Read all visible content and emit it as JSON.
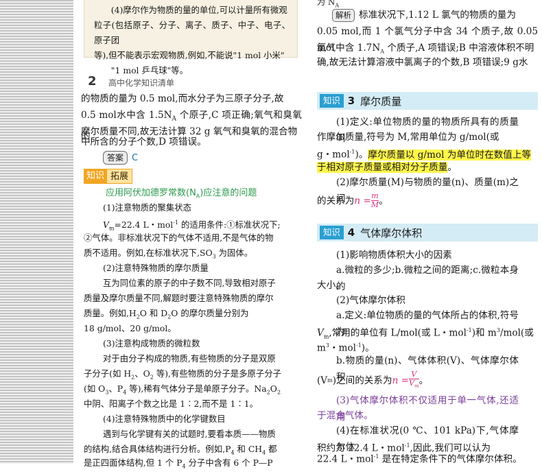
{
  "left": {
    "note": [
      "(4)摩尔作为物质的量的单位,可以计量所有微观",
      "粒子(包括原子、分子、离子、质子、中子、电子、原子团",
      "等),但不能表示宏观物质,例如,不能说\"1 mol 小米\"",
      "\"1 mol 乒乓球\"等。"
    ],
    "page_number": "2",
    "page_title": "高中化学知识清单",
    "para": [
      "的物质的量为 0.5 mol,而水分子为三原子分子,故",
      "0.5 mol水中含 1.5N",
      "A",
      " 个原子,C 项正确;氧气和臭氧的",
      "摩尔质量不同,故无法计算 32 g 氧气和臭氧的混合物",
      "中所含的分子个数,D 项错误。"
    ],
    "answer_label": "答案",
    "answer_value": "C",
    "ext_tag_a": "知识",
    "ext_tag_b": "拓展",
    "ext_title": "应用阿伏加德罗常数(N",
    "ext_title_sub": "A",
    "ext_title_end": ")应注意的问题",
    "ext_lines": [
      "(1)注意物质的聚集状态",
      "V",
      "m",
      "=22.4 L・mol",
      "-1",
      " 的适用条件:①标准状况下;",
      "②气体。非标准状况下的气体不适用,不是气体的物",
      "质不适用。例如,在标准状况下,SO",
      "3",
      " 为固体。",
      "(2)注意特殊物质的摩尔质量",
      "互为同位素的原子的中子数不同,导致相对原子",
      "质量及摩尔质量不同,解题时要注意特殊物质的摩尔",
      "质量。例如,H",
      "2",
      "O 和 D",
      "2",
      "O 的摩尔质量分别为",
      "18 g/mol、20 g/mol。",
      "(3)注意构成物质的微粒数",
      "对于由分子构成的物质,有些物质的分子是双原",
      "子分子(如 H",
      "2",
      "、O",
      "2",
      " 等),有些物质的分子是多原子分子",
      "(如 O",
      "3",
      "、P",
      "4",
      " 等),稀有气体分子是单原子分子。Na",
      "2",
      "O",
      "2",
      "中阴、阳离子个数之比是 1∶2,而不是 1∶1。",
      "(4)注意特殊物质中的化学键数目",
      "遇到与化学键有关的试题时,要看本质——物质",
      "的结构,结合具体结构进行分析。例如,P",
      "4",
      " 和 CH",
      "4",
      " 都",
      "是正四面体结构,但 1 个 P",
      "4",
      " 分子中含有 6 个 P—P"
    ]
  },
  "right": {
    "top_na": "为 N",
    "top_na_sub": "A",
    "analysis_label": "解析",
    "analysis": [
      "标准状况下,1.12 L 氯气的物质的量为",
      "0.05 mol,而 1 个氯气分子中含 34 个质子,故 0.05 mol",
      "氯气中含 1.7N",
      "A",
      " 个质子,A 项错误;B 中溶液体积不明",
      "确,故无法计算溶液中氯离子的个数,B 项错误;9 g水"
    ],
    "sec3_tag": "知识",
    "sec3_num": "3",
    "sec3_title": "摩尔质量",
    "sec3": [
      "(1)定义:单位物质的量的物质所具有的质量叫",
      "作摩尔质量,符号为 M,常用单位为 g/mol(或",
      "g・mol",
      "-1",
      ")。",
      "摩尔质量以 g/mol 为单位时在数值上等",
      "于相对原子质量或相对分子质量",
      "。",
      "(2)摩尔质量(M)与物质的量(n)、质量(m)之间",
      "的关系为",
      "n = ",
      "m",
      "M",
      "。"
    ],
    "sec4_tag": "知识",
    "sec4_num": "4",
    "sec4_title": "气体摩尔体积",
    "sec4": [
      "(1)影响物质体积大小的因素",
      "a.微粒的多少;b.微粒之间的距离;c.微粒本身的",
      "大小。",
      "(2)气体摩尔体积",
      "a.定义:单位物质的量的气体所占的体积,符号为",
      "V",
      "m",
      ",常用的单位有 L/mol(或 L・mol",
      "-1",
      ")和 m",
      "3",
      "/mol(或",
      "m",
      "3",
      "・mol",
      "-1",
      ")。",
      "b.物质的量(n)、气体体积(V)、气体摩尔体积",
      "(V",
      "m",
      ")之间的关系为",
      "n = ",
      "V",
      "V",
      "m",
      "。",
      "(3)气体摩尔体积不仅适用于单一气体,还适用",
      "于混合气体。",
      "(4)在标准状况(0 ℃、101 kPa)下,气体摩尔体",
      "积约为 22.4 L・mol",
      "-1",
      ",因此,我们可以认为",
      "22.4 L・mol",
      "-1",
      " 是在特定条件下的气体摩尔体积。"
    ]
  }
}
